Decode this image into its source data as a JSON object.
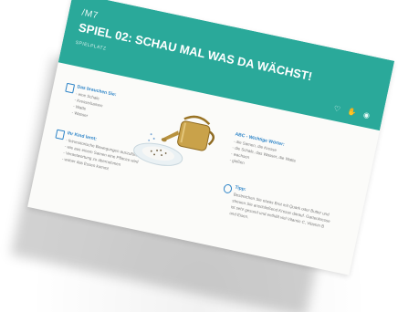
{
  "card": {
    "code": "/M7",
    "title": "SPIEL 02: SCHAU MAL WAS DA WÄCHST!",
    "subtitle": "SPIELPLATZ",
    "header_icons": [
      "heart-icon",
      "hand-icon",
      "eye-icon"
    ],
    "colors": {
      "header": "#2aa99a",
      "section_title": "#2d84c8",
      "body_text": "#7b7b7b",
      "card_bg": "#fbfbf9"
    }
  },
  "needs": {
    "title": "Das brauchen Sie:",
    "items": [
      "- eine Schale",
      "- Kresse/samen",
      "- Watte",
      "- Wasser"
    ]
  },
  "learns": {
    "title": "Ihr Kind lernt:",
    "items": [
      "- feinmotorische Bewegungen auszuführen",
      "- wie aus einem Samen eine Pflanze wird",
      "- Verantwortung zu übernehmen",
      "- woher das Essen kommt"
    ]
  },
  "words": {
    "title": "ABC - Wichtige Wörter:",
    "items": [
      "- die Samen, die Kresse",
      "- die Schale, das Wasser, die Watte",
      "- wachsen",
      "- gießen"
    ]
  },
  "tip": {
    "title": "Tipp:",
    "lines": [
      "Bestreichen Sie etwas Brot mit Quark oder Butter und",
      "streuen Sie anschließend Kresse darauf. Gartenkresse",
      "ist sehr gesund und enthält viel Vitamin C, Vitamin B",
      "und Eisen."
    ]
  }
}
